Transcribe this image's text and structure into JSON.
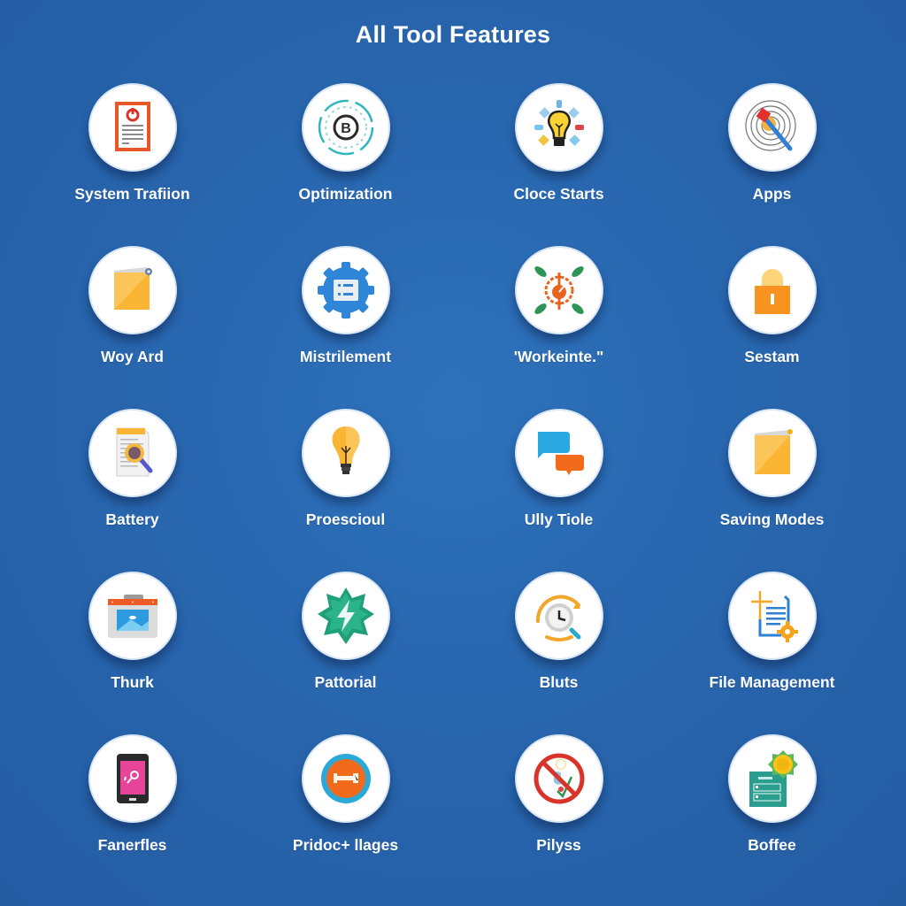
{
  "header": {
    "title": "All Tool Features"
  },
  "features": [
    {
      "label": "System Trafiion",
      "icon": "document-power-icon"
    },
    {
      "label": "Optimization",
      "icon": "bitcoin-ring-icon"
    },
    {
      "label": "Cloce Starts",
      "icon": "lightbulb-idea-icon"
    },
    {
      "label": "Apps",
      "icon": "target-dart-icon"
    },
    {
      "label": "Woy Ard",
      "icon": "folder-icon"
    },
    {
      "label": "Mistrilement",
      "icon": "gear-settings-icon"
    },
    {
      "label": "'Workeinte.\"",
      "icon": "power-leaf-icon"
    },
    {
      "label": "Sestam",
      "icon": "lock-icon"
    },
    {
      "label": "Battery",
      "icon": "document-search-icon"
    },
    {
      "label": "Proescioul",
      "icon": "lightbulb-icon"
    },
    {
      "label": "Ully Tiole",
      "icon": "chat-bubbles-icon"
    },
    {
      "label": "Saving Modes",
      "icon": "folder-icon"
    },
    {
      "label": "Thurk",
      "icon": "image-window-icon"
    },
    {
      "label": "Pattorial",
      "icon": "lightning-badge-icon"
    },
    {
      "label": "Bluts",
      "icon": "clock-search-icon"
    },
    {
      "label": "File Management",
      "icon": "file-gear-icon"
    },
    {
      "label": "Fanerfles",
      "icon": "tablet-icon"
    },
    {
      "label": "Pridoc+ llages",
      "icon": "link-button-icon"
    },
    {
      "label": "Pilyss",
      "icon": "prohibited-icon"
    },
    {
      "label": "Boffee",
      "icon": "panel-gear-icon"
    }
  ]
}
